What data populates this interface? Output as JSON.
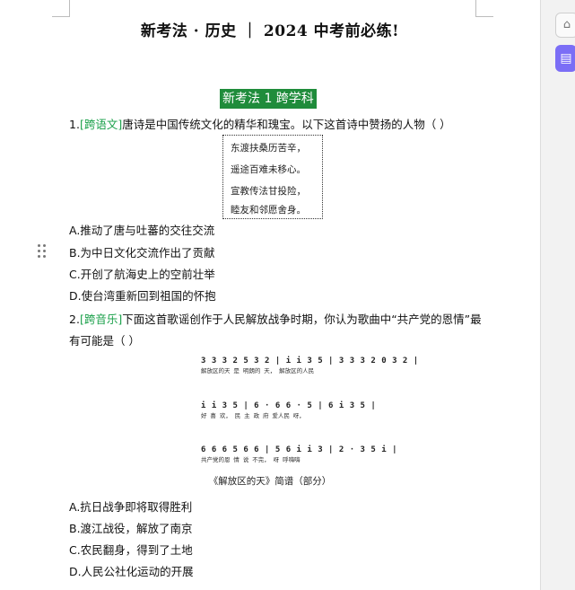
{
  "doc": {
    "title": "新考法 · 历史 ｜ 2024 中考前必练!",
    "section": "新考法 1   跨学科"
  },
  "q1": {
    "number": "1.",
    "tag": "[跨语文]",
    "stem": "唐诗是中国传统文化的精华和瑰宝。以下这首诗中赞扬的人物（      ）",
    "poem": [
      "东渡扶桑历苦辛，",
      "遥途百难未移心。",
      "宣教传法甘投险，",
      "睦友和邻愿舍身。"
    ],
    "options": [
      "A.推动了唐与吐蕃的交往交流",
      "B.为中日文化交流作出了贡献",
      "C.开创了航海史上的空前壮举",
      "D.使台湾重新回到祖国的怀抱"
    ]
  },
  "q2": {
    "number": "2.",
    "tag": "[跨音乐]",
    "stem_line1": "下面这首歌谣创作于人民解放战争时期，你认为歌曲中“共产党的恩情”最",
    "stem_line2": "有可能是（      ）",
    "score": [
      {
        "notes": "3 3 3 2 5  3 2 | i i 3 5  | 3 3 3 2 0 3 2 |",
        "lyrics": "解放区的天  是  明朗的 天，  解放区的人民"
      },
      {
        "notes": "i  i 3  5  | 6 · 6 6 · 5 | 6 i  3  5 |",
        "lyrics": "好  喜  欢，  民  主  政  府    爱人民 呀，"
      },
      {
        "notes": "6 6 6 5 6 6 | 5 6 i  i 3 | 2 · 3 5 i |",
        "lyrics": "共产党的恩 情   说   不完，   呀  呼嗨嗨"
      }
    ],
    "caption": "《解放区的天》简谱（部分）",
    "options": [
      "A.抗日战争即将取得胜利",
      "B.渡江战役，解放了南京",
      "C.农民翻身，得到了土地",
      "D.人民公社化运动的开展"
    ]
  },
  "ui": {
    "sidebar_btn1": "⌂",
    "sidebar_btn2": "▤"
  }
}
